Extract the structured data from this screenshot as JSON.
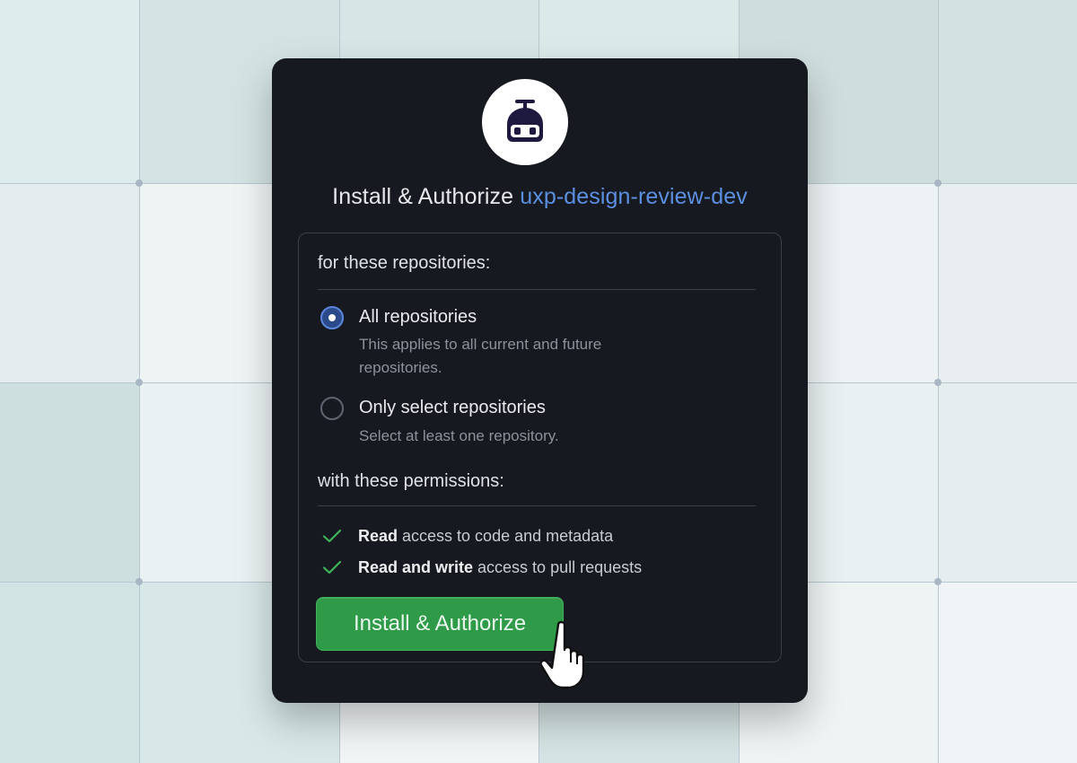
{
  "dialog": {
    "title_prefix": "Install & Authorize",
    "app_name": "uxp-design-review-dev",
    "logo_icon": "robot-icon"
  },
  "repositories": {
    "heading": "for these repositories:",
    "options": [
      {
        "label": "All repositories",
        "description": "This applies to all current and future repositories.",
        "selected": true
      },
      {
        "label": "Only select repositories",
        "description": "Select at least one repository.",
        "selected": false
      }
    ]
  },
  "permissions": {
    "heading": "with these permissions:",
    "items": [
      {
        "bold": "Read",
        "rest": " access to code and metadata"
      },
      {
        "bold": "Read and write",
        "rest": " access to pull requests"
      }
    ]
  },
  "actions": {
    "install_label": "Install & Authorize"
  },
  "colors": {
    "accent_link": "#5b8fe0",
    "button_green": "#2f9a47",
    "check_green": "#3fb35a",
    "radio_blue": "#5b86dd",
    "card_bg": "#16191f"
  }
}
